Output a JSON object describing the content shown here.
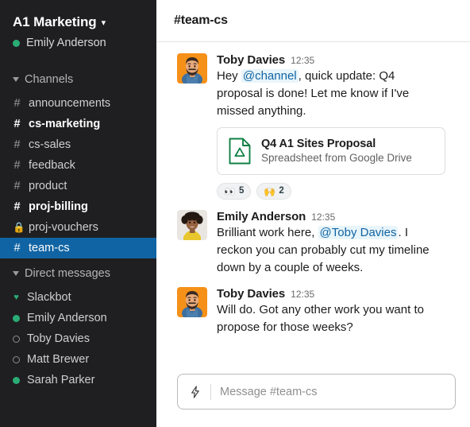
{
  "sidebar": {
    "workspace": {
      "name": "A1 Marketing",
      "chevron": "chevron-down-icon",
      "user": "Emily Anderson",
      "user_presence": "online"
    },
    "channels_section": {
      "label": "Channels",
      "items": [
        {
          "name": "announcements",
          "symbol": "#",
          "unread": false,
          "private": false,
          "selected": false
        },
        {
          "name": "cs-marketing",
          "symbol": "#",
          "unread": true,
          "private": false,
          "selected": false
        },
        {
          "name": "cs-sales",
          "symbol": "#",
          "unread": false,
          "private": false,
          "selected": false
        },
        {
          "name": "feedback",
          "symbol": "#",
          "unread": false,
          "private": false,
          "selected": false
        },
        {
          "name": "product",
          "symbol": "#",
          "unread": false,
          "private": false,
          "selected": false
        },
        {
          "name": "proj-billing",
          "symbol": "#",
          "unread": true,
          "private": false,
          "selected": false
        },
        {
          "name": "proj-vouchers",
          "symbol": "🔒",
          "unread": false,
          "private": true,
          "selected": false
        },
        {
          "name": "team-cs",
          "symbol": "#",
          "unread": false,
          "private": false,
          "selected": true
        }
      ]
    },
    "dms_section": {
      "label": "Direct messages",
      "items": [
        {
          "name": "Slackbot",
          "presence": "heart"
        },
        {
          "name": "Emily Anderson",
          "presence": "online"
        },
        {
          "name": "Toby Davies",
          "presence": "offline"
        },
        {
          "name": "Matt Brewer",
          "presence": "offline"
        },
        {
          "name": "Sarah Parker",
          "presence": "online"
        }
      ]
    }
  },
  "header": {
    "hash": "#",
    "channel": "team-cs"
  },
  "messages": [
    {
      "author": "Toby Davies",
      "time": "12:35",
      "avatar": "toby-avatar",
      "text_pre": "Hey ",
      "mention": "@channel",
      "text_post": ", quick update: Q4 proposal is done! Let me know if I've missed anything.",
      "attachment": {
        "title": "Q4 A1 Sites Proposal",
        "subtitle": "Spreadsheet from Google Drive",
        "icon": "google-drive-file-icon"
      },
      "reactions": [
        {
          "emoji": "👀",
          "name": "eyes",
          "count": "5"
        },
        {
          "emoji": "🙌",
          "name": "raised-hands",
          "count": "2"
        }
      ]
    },
    {
      "author": "Emily Anderson",
      "time": "12:35",
      "avatar": "emily-avatar",
      "text_pre": "Brilliant work here, ",
      "mention": "@Toby Davies",
      "text_post": ". I reckon you can probably cut my timeline down by a couple of weeks."
    },
    {
      "author": "Toby Davies",
      "time": "12:35",
      "avatar": "toby-avatar",
      "text_pre": "Will do. Got any other work you want to propose for those weeks?",
      "mention": "",
      "text_post": ""
    }
  ],
  "composer": {
    "placeholder": "Message #team-cs",
    "shortcut_icon": "lightning-bolt-icon"
  },
  "colors": {
    "sidebar_bg": "#1f1f21",
    "selected_channel": "#1164a3",
    "online_green": "#2bac76",
    "mention_blue": "#1164a3",
    "mention_bg": "#e8f5fa",
    "drive_green": "#0f8043",
    "avatar_orange": "#f59019"
  }
}
